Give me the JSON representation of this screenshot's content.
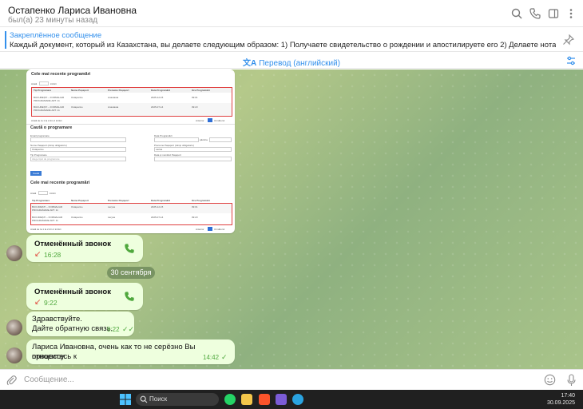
{
  "header": {
    "contact_name": "Остапенко Лариса Ивановна",
    "status": "был(а) 23 минуты назад",
    "icons": [
      "search-icon",
      "phone-icon",
      "sidebar-icon",
      "more-vertical-icon"
    ]
  },
  "pinned": {
    "title": "Закреплённое сообщение",
    "text": "Каждый документ, который из Казахстана, вы делаете следующим образом: 1) Получаете свидетельство о рождении и апостилируете его 2) Делаете нотариальный перевод на р..."
  },
  "translate": {
    "label": "Перевод (английский)"
  },
  "screenshot_image": {
    "section1_title": "Cele mai recente programări",
    "show_label": "Arată",
    "entries_label": "intrări",
    "columns": [
      "Tip Programare",
      "Nume Pașaport",
      "Prenume Pașaport",
      "Data Programării",
      "Ora Programării"
    ],
    "rows_top": [
      [
        "BUCUREȘTI – FORMALIAR PROGRAMARE ART. 11",
        "Ostapenko",
        "Anastasia",
        "2025-12-15",
        "09:01"
      ],
      [
        "BUCUREȘTI – FORMALIAR PROGRAMARE ART. 11",
        "Ostapenko",
        "Anastasia",
        "2025-07-14",
        "09:23"
      ]
    ],
    "footer_text": "Arată de la 1 la 2 din 2 intrări",
    "prev_label": "Anterior",
    "next_label": "Următorul",
    "page_number": "1",
    "search_title": "Caută o programare",
    "field_labels": [
      "Email programare",
      "Data Programării",
      "până la",
      "Nume Pașaport (câmp obligatoriu)",
      "Prenume Pașaport (câmp obligatoriu)",
      "Tip Programare",
      "Data și numărul Pașaport"
    ],
    "field_values": [
      "Ostapenko",
      "Larisa",
      "Alege tipul de programare"
    ],
    "search_button": "Caută",
    "section2_title": "Cele mai recente programări",
    "rows_bottom": [
      [
        "BUCUREȘTI – FORMALIAR PROGRAMARE ART. 11",
        "Ostapenko",
        "Larysa",
        "2025-12-15",
        "09:01"
      ],
      [
        "BUCUREȘTI – FORMALIAR PROGRAMARE ART. 11",
        "Ostapenko",
        "Larysa",
        "2025-07-14",
        "09:23"
      ]
    ]
  },
  "messages": {
    "call1": {
      "title": "Отменённый звонок",
      "time": "16:28"
    },
    "date_separator": "30 сентября",
    "call2": {
      "title": "Отменённый звонок",
      "time": "9:22"
    },
    "msg1": {
      "line1": "Здравствуйте.",
      "line2": "Дайте обратную связь.",
      "time": "9:22"
    },
    "msg2": {
      "line1": "Лариса Ивановна, очень как то не серёзно Вы относитесь к",
      "line2": "процессу.",
      "time": "14:42"
    }
  },
  "composer": {
    "placeholder": "Сообщение..."
  },
  "taskbar": {
    "search_label": "Поиск",
    "time": "17:40",
    "date": "30.09.2025"
  },
  "colors": {
    "accent": "#3390ec",
    "bubble": "#eeffde",
    "missed_call": "#e0463a",
    "time_green": "#4fa83d",
    "highlight_box": "#e04040"
  }
}
